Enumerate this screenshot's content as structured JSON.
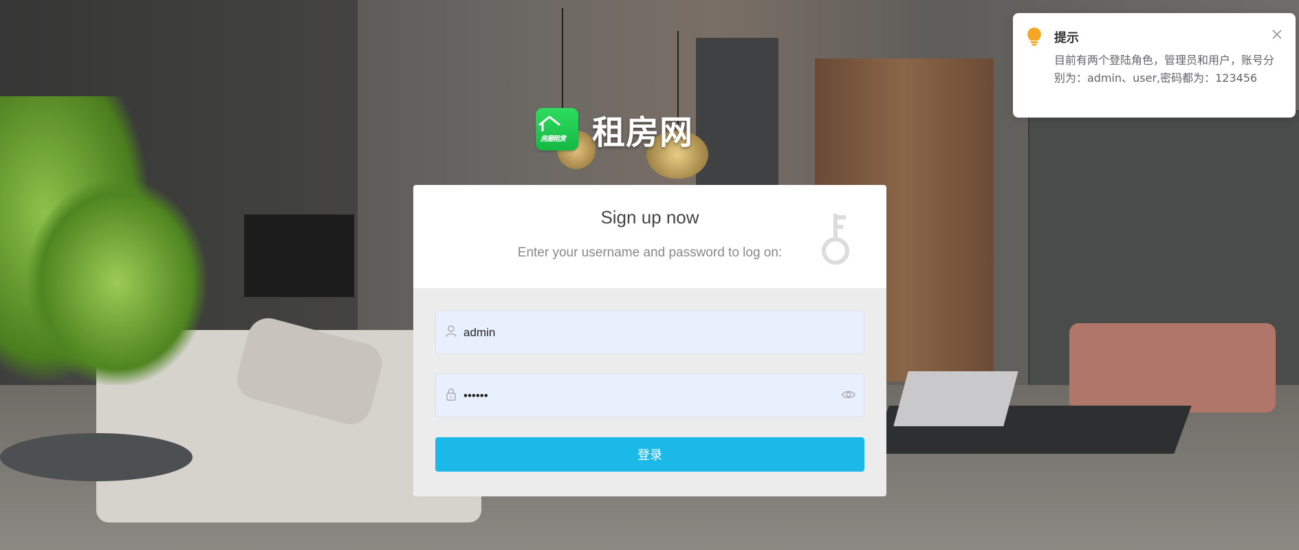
{
  "brand": {
    "logo_text": "房屋租赁",
    "name": "租房网"
  },
  "login": {
    "title": "Sign up now",
    "subtitle": "Enter your username and password to log on:",
    "username_value": "admin",
    "password_value": "123456",
    "submit_label": "登录"
  },
  "notification": {
    "title": "提示",
    "message": "目前有两个登陆角色，管理员和用户，账号分别为：admin、user,密码都为：123456"
  },
  "colors": {
    "accent": "#1bb9e8",
    "logo_green": "#22c94f",
    "notify_icon": "#f5a623"
  },
  "icons": {
    "brand": "house-icon",
    "card": "key-icon",
    "username": "user-icon",
    "password": "lock-icon",
    "password_toggle": "eye-icon",
    "notification": "lightbulb-icon",
    "close": "close-icon"
  }
}
